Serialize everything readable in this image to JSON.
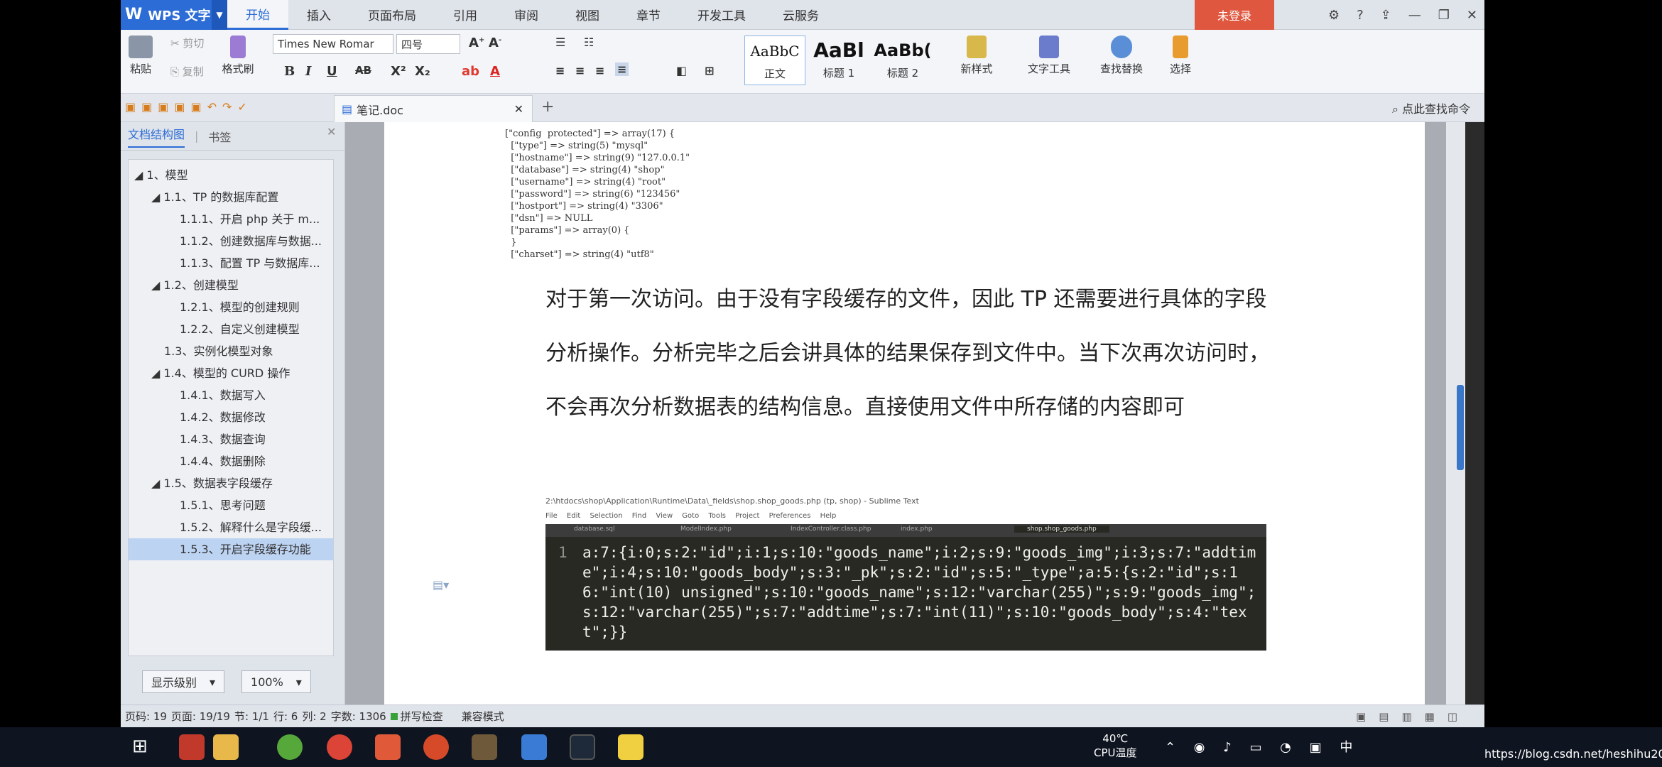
{
  "app": {
    "name": "WPS 文字",
    "logo_letter": "W"
  },
  "menu": {
    "tabs": [
      "开始",
      "插入",
      "页面布局",
      "引用",
      "审阅",
      "视图",
      "章节",
      "开发工具",
      "云服务"
    ],
    "active": "开始",
    "login": "未登录"
  },
  "ribbon": {
    "paste": "粘贴",
    "cut": "剪切",
    "copy": "复制",
    "format_painter": "格式刷",
    "font_name": "Times New Romar",
    "font_size": "四号",
    "styles": [
      {
        "sample": "AaBbC",
        "label": "正文"
      },
      {
        "sample": "AaBl",
        "label": "标题 1"
      },
      {
        "sample": "AaBb(",
        "label": "标题 2"
      }
    ],
    "new_style": "新样式",
    "text_tools": "文字工具",
    "find_replace": "查找替换",
    "select": "选择"
  },
  "doc_tab": {
    "title": "笔记.doc"
  },
  "find_command": "点此查找命令",
  "nav": {
    "tabs": [
      "文档结构图",
      "书签"
    ],
    "items": [
      {
        "text": "1、模型",
        "level": 0
      },
      {
        "text": "1.1、TP 的数据库配置",
        "level": 1
      },
      {
        "text": "1.1.1、开启 php 关于 m...",
        "level": 2
      },
      {
        "text": "1.1.2、创建数据库与数据...",
        "level": 2
      },
      {
        "text": "1.1.3、配置 TP 与数据库...",
        "level": 2
      },
      {
        "text": "1.2、创建模型",
        "level": 1
      },
      {
        "text": "1.2.1、模型的创建规则",
        "level": 2
      },
      {
        "text": "1.2.2、自定义创建模型",
        "level": 2
      },
      {
        "text": "1.3、实例化模型对象",
        "level": 1
      },
      {
        "text": "1.4、模型的 CURD 操作",
        "level": 1
      },
      {
        "text": "1.4.1、数据写入",
        "level": 2
      },
      {
        "text": "1.4.2、数据修改",
        "level": 2
      },
      {
        "text": "1.4.3、数据查询",
        "level": 2
      },
      {
        "text": "1.4.4、数据删除",
        "level": 2
      },
      {
        "text": "1.5、数据表字段缓存",
        "level": 1
      },
      {
        "text": "1.5.1、思考问题",
        "level": 2
      },
      {
        "text": "1.5.2、解释什么是字段缓...",
        "level": 2
      },
      {
        "text": "1.5.3、开启字段缓存功能",
        "level": 2
      }
    ],
    "selected_index": 17,
    "show_level": "显示级别",
    "zoom": "100%"
  },
  "document": {
    "config_dump": "[\"config  protected\"] => array(17) {\n  [\"type\"] => string(5) \"mysql\"\n  [\"hostname\"] => string(9) \"127.0.0.1\"\n  [\"database\"] => string(4) \"shop\"\n  [\"username\"] => string(4) \"root\"\n  [\"password\"] => string(6) \"123456\"\n  [\"hostport\"] => string(4) \"3306\"\n  [\"dsn\"] => NULL\n  [\"params\"] => array(0) {\n  }\n  [\"charset\"] => string(4) \"utf8\"",
    "paragraph": "对于第一次访问。由于没有字段缓存的文件，因此 TP 还需要进行具体的字段分析操作。分析完毕之后会讲具体的结果保存到文件中。当下次再次访问时，不会再次分析数据表的结构信息。直接使用文件中所存储的内容即可",
    "sublime_title": "2:\\htdocs\\shop\\Application\\Runtime\\Data\\_fields\\shop.shop_goods.php (tp, shop) - Sublime Text",
    "sublime_tabs": [
      "database.sql",
      "ModelIndex.php",
      "IndexController.class.php",
      "index.php",
      "shop.shop_goods.php"
    ],
    "line_number": "1",
    "code": "a:7:{i:0;s:2:\"id\";i:1;s:10:\"goods_name\";i:2;s:9:\"goods_img\";i:3;s:7:\"addtime\";i:4;s:10:\"goods_body\";s:3:\"_pk\";s:2:\"id\";s:5:\"_type\";a:5:{s:2:\"id\";s:16:\"int(10) unsigned\";s:10:\"goods_name\";s:12:\"varchar(255)\";s:9:\"goods_img\";s:12:\"varchar(255)\";s:7:\"addtime\";s:7:\"int(11)\";s:10:\"goods_body\";s:4:\"text\";}}"
  },
  "status": {
    "page_no": "页码: 19",
    "pages": "页面: 19/19",
    "section": "节: 1/1",
    "line": "行: 6",
    "col": "列: 2",
    "word_count": "字数: 1306",
    "spell_check": "拼写检查",
    "compat_mode": "兼容模式"
  },
  "taskbar": {
    "temp": "40℃",
    "cpu_label": "CPU温度",
    "ime": "中"
  },
  "watermark": "https://blog.csdn.net/heshihu2019"
}
